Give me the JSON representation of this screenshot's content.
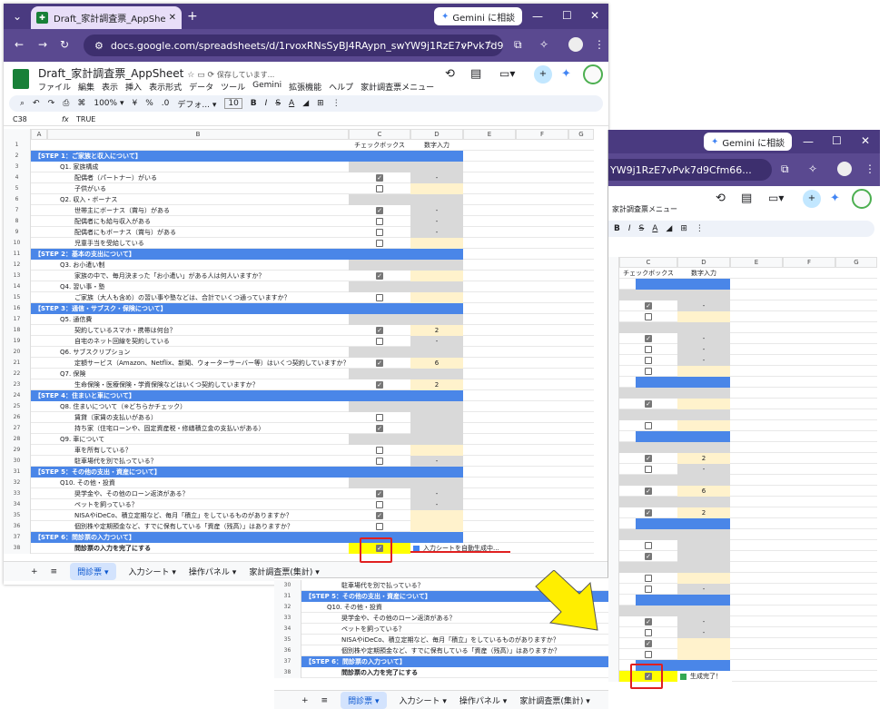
{
  "browser": {
    "tab_title": "Draft_家計調査票_AppSheet - G",
    "gemini_label": "Gemini に相談",
    "url": "docs.google.com/spreadsheets/d/1rvoxRNsSyBJ4RAypn_swYW9j1RzE7vPvk7d9Cfm66...",
    "url2": "YW9j1RzE7vPvk7d9Cfm66..."
  },
  "sheet": {
    "title": "Draft_家計調査票_AppSheet",
    "saving": "保存しています...",
    "menus": [
      "ファイル",
      "編集",
      "表示",
      "挿入",
      "表示形式",
      "データ",
      "ツール",
      "Gemini",
      "拡張機能",
      "ヘルプ",
      "家計調査票メニュー"
    ],
    "custom_menu": "家計調査票メニュー",
    "zoom": "100%",
    "font": "デフォ...",
    "font_size": "10",
    "cell_ref": "C38",
    "formula": "TRUE"
  },
  "columns": [
    "A",
    "B",
    "C",
    "D",
    "E",
    "F",
    "G"
  ],
  "header_row": {
    "c": "チェックボックス",
    "d": "数字入力"
  },
  "rows": [
    {
      "n": "1"
    },
    {
      "n": "2",
      "t": "【STEP 1：ご家族と収入について】",
      "s": 1
    },
    {
      "n": "3",
      "t": "Q1. 家族構成",
      "i": 1,
      "g": 1
    },
    {
      "n": "4",
      "t": "配偶者（パートナー）がいる",
      "i": 2,
      "cb": 1,
      "d": "-"
    },
    {
      "n": "5",
      "t": "子供がいる",
      "i": 2,
      "cb": 0,
      "y": 1
    },
    {
      "n": "6",
      "t": "Q2. 収入・ボーナス",
      "i": 1,
      "g": 1
    },
    {
      "n": "7",
      "t": "世帯主にボーナス（賞与）がある",
      "i": 2,
      "cb": 1,
      "d": "-"
    },
    {
      "n": "8",
      "t": "配偶者にも給与収入がある",
      "i": 2,
      "cb": 0,
      "d": "-"
    },
    {
      "n": "9",
      "t": "配偶者にもボーナス（賞与）がある",
      "i": 2,
      "cb": 0,
      "d": "-"
    },
    {
      "n": "10",
      "t": "児童手当を受給している",
      "i": 2,
      "cb": 0,
      "y": 1
    },
    {
      "n": "11",
      "t": "【STEP 2：基本の支出について】",
      "s": 1
    },
    {
      "n": "12",
      "t": "Q3. お小遣い制",
      "i": 1,
      "g": 1
    },
    {
      "n": "13",
      "t": "家族の中で、毎月決まった「お小遣い」がある人は何人いますか？",
      "i": 2,
      "cb": 1,
      "y": 1
    },
    {
      "n": "14",
      "t": "Q4. 習い事・塾",
      "i": 1,
      "g": 1
    },
    {
      "n": "15",
      "t": "ご家族（大人も含め）の習い事や塾などは、合計でいくつ通っていますか？",
      "i": 2,
      "cb": 0,
      "y": 1
    },
    {
      "n": "16",
      "t": "【STEP 3：通信・サブスク・保険について】",
      "s": 1
    },
    {
      "n": "17",
      "t": "Q5. 通信費",
      "i": 1,
      "g": 1
    },
    {
      "n": "18",
      "t": "契約しているスマホ・携帯は何台？",
      "i": 2,
      "cb": 1,
      "d": "2",
      "y": 1
    },
    {
      "n": "19",
      "t": "自宅のネット回線を契約している",
      "i": 2,
      "cb": 0,
      "d": "-"
    },
    {
      "n": "20",
      "t": "Q6. サブスクリプション",
      "i": 1,
      "g": 1
    },
    {
      "n": "21",
      "t": "定額サービス（Amazon、Netflix、新聞、ウォーターサーバー等）はいくつ契約していますか？",
      "i": 2,
      "cb": 1,
      "d": "6",
      "y": 1
    },
    {
      "n": "22",
      "t": "Q7. 保険",
      "i": 1,
      "g": 1
    },
    {
      "n": "23",
      "t": "生命保険・医療保険・学資保険などはいくつ契約していますか？",
      "i": 2,
      "cb": 1,
      "d": "2",
      "y": 1
    },
    {
      "n": "24",
      "t": "【STEP 4：住まいと車について】",
      "s": 1
    },
    {
      "n": "25",
      "t": "Q8. 住まいについて（※どちらかチェック）",
      "i": 1,
      "g": 1
    },
    {
      "n": "26",
      "t": "賃貸（家賃の支払いがある）",
      "i": 2,
      "cb": 0,
      "d": ""
    },
    {
      "n": "27",
      "t": "持ち家（住宅ローンや、固定資産税・修繕積立金の支払いがある）",
      "i": 2,
      "cb": 1,
      "d": ""
    },
    {
      "n": "28",
      "t": "Q9. 車について",
      "i": 1,
      "g": 1
    },
    {
      "n": "29",
      "t": "車を所有している？",
      "i": 2,
      "cb": 0,
      "y": 1
    },
    {
      "n": "30",
      "t": "駐車場代を別で払っている？",
      "i": 2,
      "cb": 0,
      "d": "-"
    },
    {
      "n": "31",
      "t": "【STEP 5：その他の支出・資産について】",
      "s": 1
    },
    {
      "n": "32",
      "t": "Q10. その他・投資",
      "i": 1,
      "g": 1
    },
    {
      "n": "33",
      "t": "奨学金や、その他のローン返済がある？",
      "i": 2,
      "cb": 1,
      "d": "-"
    },
    {
      "n": "34",
      "t": "ペットを飼っている？",
      "i": 2,
      "cb": 0,
      "d": "-"
    },
    {
      "n": "35",
      "t": "NISAやiDeCo、積立定期など、毎月「積立」をしているものがありますか？",
      "i": 2,
      "cb": 1,
      "y": 1
    },
    {
      "n": "36",
      "t": "個別株や定期預金など、すでに保有している「資産（残高）」はありますか？",
      "i": 2,
      "cb": 0,
      "y": 1
    },
    {
      "n": "37",
      "t": "【STEP 6：問診票の入力ついて】",
      "s": 1
    },
    {
      "n": "38",
      "t": "問診票の入力を完了にする",
      "i": 2,
      "cb": 1,
      "b": 1
    }
  ],
  "status_before": "入力シートを自動生成中...",
  "status_after": "生成完了！",
  "tabs": [
    "問診票",
    "入力シート",
    "操作パネル",
    "家計調査票(集計)"
  ]
}
